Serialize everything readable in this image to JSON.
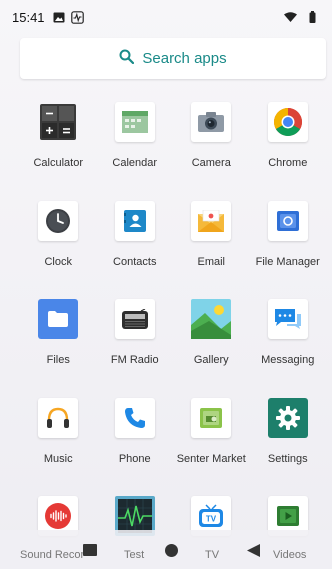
{
  "status": {
    "time": "15:41"
  },
  "search": {
    "label": "Search apps"
  },
  "apps": [
    {
      "label": "Calculator",
      "icon": "calculator-icon"
    },
    {
      "label": "Calendar",
      "icon": "calendar-icon"
    },
    {
      "label": "Camera",
      "icon": "camera-icon"
    },
    {
      "label": "Chrome",
      "icon": "chrome-icon"
    },
    {
      "label": "Clock",
      "icon": "clock-icon"
    },
    {
      "label": "Contacts",
      "icon": "contacts-icon"
    },
    {
      "label": "Email",
      "icon": "email-icon"
    },
    {
      "label": "File Manager",
      "icon": "file-manager-icon"
    },
    {
      "label": "Files",
      "icon": "files-icon"
    },
    {
      "label": "FM Radio",
      "icon": "fm-radio-icon"
    },
    {
      "label": "Gallery",
      "icon": "gallery-icon"
    },
    {
      "label": "Messaging",
      "icon": "messaging-icon"
    },
    {
      "label": "Music",
      "icon": "music-icon"
    },
    {
      "label": "Phone",
      "icon": "phone-icon"
    },
    {
      "label": "Senter Market",
      "icon": "senter-market-icon"
    },
    {
      "label": "Settings",
      "icon": "settings-icon"
    },
    {
      "label": "Sound Recorder",
      "icon": "sound-recorder-icon"
    },
    {
      "label": "Test",
      "icon": "test-icon"
    },
    {
      "label": "TV",
      "icon": "tv-icon"
    },
    {
      "label": "Videos",
      "icon": "videos-icon"
    }
  ],
  "navbar": {
    "labels": [
      "Sound Recor",
      "Test",
      "TV",
      "Videos"
    ]
  },
  "colors": {
    "accent": "#1a8a88",
    "settings_bg": "#1d7f6b",
    "files_bg": "#4a86e8"
  }
}
